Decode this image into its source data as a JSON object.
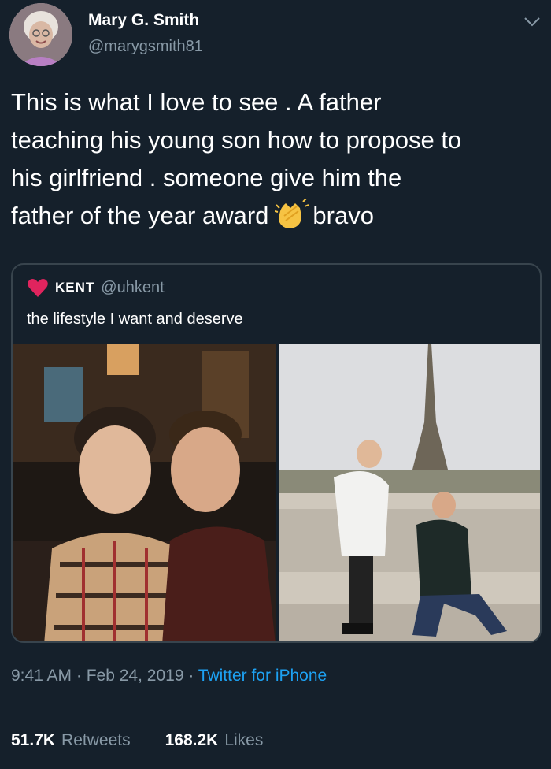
{
  "author": {
    "name": "Mary G. Smith",
    "handle": "@marygsmith81"
  },
  "tweet": {
    "line1": "This is what I love to see . A father",
    "line2": "teaching his young son how to propose to",
    "line3": "his girlfriend . someone give him the",
    "line4_before": "father of the year award",
    "line4_after": "bravo",
    "emoji_icon": "clapping-hands-icon"
  },
  "quoted": {
    "name": "KENT",
    "handle": "@uhkent",
    "text": "the lifestyle I want and deserve",
    "heart_color": "#e0245e"
  },
  "meta": {
    "time": "9:41 AM",
    "date": "Feb 24, 2019",
    "source": "Twitter for iPhone"
  },
  "stats": {
    "retweets_count": "51.7K",
    "retweets_label": "Retweets",
    "likes_count": "168.2K",
    "likes_label": "Likes"
  },
  "colors": {
    "background": "#15202b",
    "link": "#1da1f2",
    "secondary": "#8899a6",
    "border": "#38444d"
  }
}
